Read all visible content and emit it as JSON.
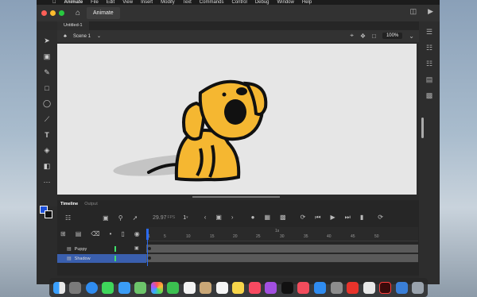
{
  "menubar": {
    "apple": "",
    "items": [
      "Animate",
      "File",
      "Edit",
      "View",
      "Insert",
      "Modify",
      "Text",
      "Commands",
      "Control",
      "Debug",
      "Window",
      "Help"
    ]
  },
  "titlebar": {
    "app_tab": "Animate"
  },
  "document": {
    "tab": "Untitled-1",
    "scene": "Scene 1",
    "zoom": "100%"
  },
  "timeline": {
    "tabs": [
      "Timeline",
      "Output"
    ],
    "fps": "29.97",
    "fps_unit": "FPS",
    "current_frame": "1",
    "ruler_marks": [
      "1",
      "5",
      "10",
      "15",
      "20",
      "25",
      "30",
      "35",
      "40",
      "45",
      "50"
    ],
    "ruler_sec": [
      "1s"
    ],
    "layers": [
      {
        "name": "Puppy",
        "selected": false
      },
      {
        "name": "Shadow",
        "selected": true
      }
    ]
  },
  "colors": {
    "accent": "#2a6af0",
    "stage": "#e6e6e6",
    "dog": "#f5b731",
    "green": "#3fe06a"
  },
  "dock": {
    "apps": [
      "finder",
      "launchpad",
      "safari",
      "messages",
      "mail",
      "maps",
      "photos",
      "facetime",
      "calendar",
      "contacts",
      "reminders",
      "notes",
      "music",
      "podcasts",
      "tv",
      "news",
      "appstore",
      "settings",
      "creative-cloud",
      "photoshop",
      "animate",
      "downloads",
      "trash"
    ]
  }
}
